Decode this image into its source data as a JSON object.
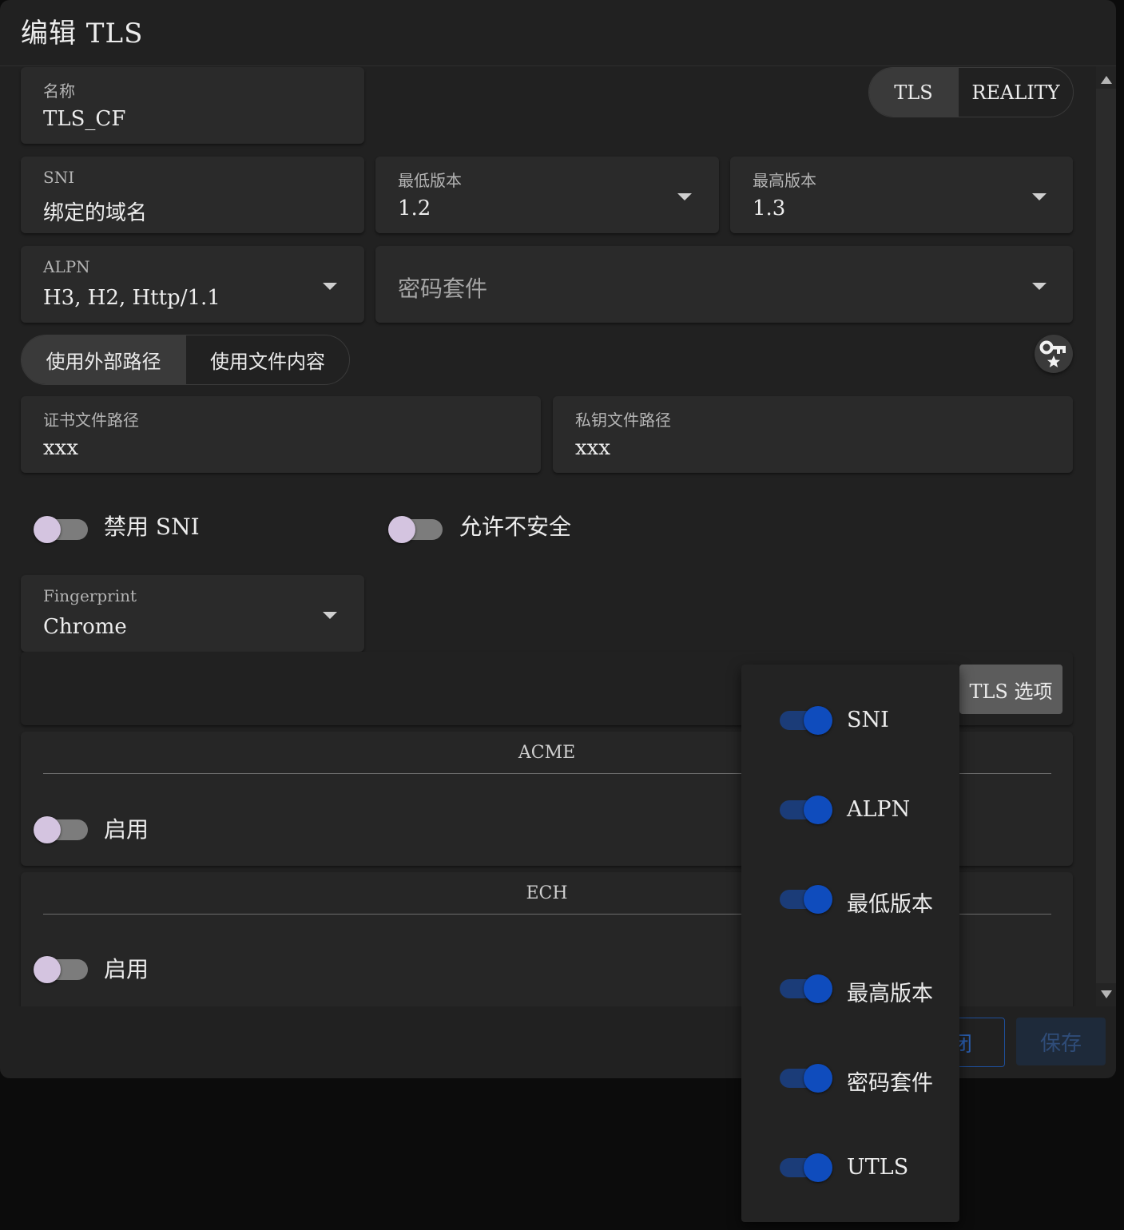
{
  "dialog": {
    "title": "编辑 TLS"
  },
  "name_field": {
    "label": "名称",
    "value": "TLS_CF"
  },
  "mode_toggle": {
    "options": [
      "TLS",
      "REALITY"
    ],
    "selected": "TLS"
  },
  "sni_field": {
    "label": "SNI",
    "value": "绑定的域名"
  },
  "min_version": {
    "label": "最低版本",
    "value": "1.2"
  },
  "max_version": {
    "label": "最高版本",
    "value": "1.3"
  },
  "alpn": {
    "label": "ALPN",
    "value": "H3, H2, Http/1.1"
  },
  "cipher_suites": {
    "placeholder": "密码套件"
  },
  "cert_source": {
    "options": [
      "使用外部路径",
      "使用文件内容"
    ],
    "selected": "使用外部路径"
  },
  "key_button": {
    "icon": "key-star-icon"
  },
  "cert_path": {
    "label": "证书文件路径",
    "value": "xxx"
  },
  "key_path": {
    "label": "私钥文件路径",
    "value": "xxx"
  },
  "disable_sni": {
    "label": "禁用 SNI",
    "checked": false
  },
  "allow_insecure": {
    "label": "允许不安全",
    "checked": false
  },
  "fingerprint": {
    "label": "Fingerprint",
    "value": "Chrome"
  },
  "tls_options_button": {
    "label": "TLS 选项"
  },
  "acme": {
    "title": "ACME",
    "enable_label": "启用",
    "enabled": false
  },
  "ech": {
    "title": "ECH",
    "enable_label": "启用",
    "enabled": false
  },
  "footer": {
    "close_label": "闭",
    "save_label": "保存"
  },
  "tls_options_menu": {
    "items": [
      {
        "label": "SNI",
        "checked": true
      },
      {
        "label": "ALPN",
        "checked": true
      },
      {
        "label": "最低版本",
        "checked": true
      },
      {
        "label": "最高版本",
        "checked": true
      },
      {
        "label": "密码套件",
        "checked": true
      },
      {
        "label": "UTLS",
        "checked": true
      }
    ]
  },
  "colors": {
    "switch_on": "#0f4cbd",
    "switch_off_knob": "#d4c4e0",
    "surface": "#2a2a2a",
    "background": "#212121"
  }
}
